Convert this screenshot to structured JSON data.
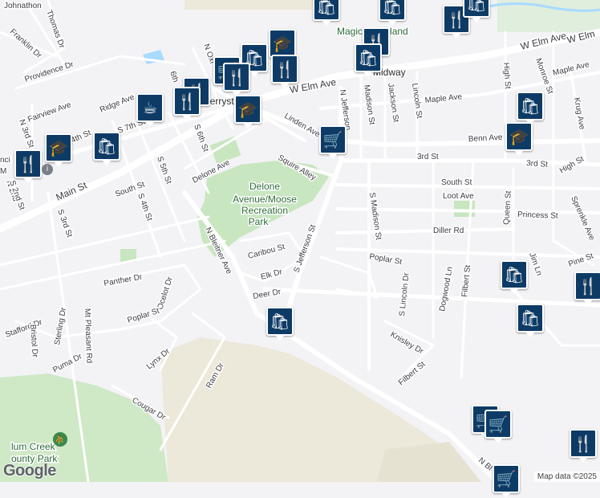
{
  "attribution": "Map data ©2025",
  "logo": "Google",
  "places": {
    "park": [
      "Delone",
      "Avenue/Moose",
      "Recreation",
      "Park"
    ],
    "midway": "Midway",
    "mcsherrystown": "herrystown",
    "skateland": "Magic    Skateland",
    "county_park": [
      "lum Creek",
      "ounty Park"
    ],
    "left_edge": [
      "nci",
      "M"
    ]
  },
  "streets": {
    "johnathon": "Johnathon",
    "thomas": "Thomas Dr",
    "franklin": "Franklin Dr",
    "providence": "Providence Dr",
    "fairview": "Fairview Ave",
    "ridge": "Ridge Ave",
    "n3rd": "N 3rd St",
    "n2nd": "N 2nd",
    "n4th": "4th St",
    "s5th": "S 5th St",
    "s6th": "S 6th St",
    "n6th": "6th",
    "s7th": "S 7th St",
    "n_oxford": "N Oxf",
    "main": "Main St",
    "south1": "South St",
    "s4th": "S 4th St",
    "s3rd": "S 3rd St",
    "s2nd": "S 2nd St",
    "delone": "Delone Ave",
    "squire": "Squire Alley",
    "linden": "Linden Ave",
    "w_elm1": "W Elm Ave",
    "w_elm2": "W Elm Ave",
    "n_jefferson": "N Jefferson",
    "madison_n": "Madison St",
    "jackson": "Jackson St",
    "lincoln_n": "Lincoln St",
    "maple1": "Maple Ave",
    "maple2": "Maple Ave",
    "benn": "Benn Ave",
    "third": "3rd St",
    "third2": "3rd St",
    "south2": "South St",
    "loot": "Loot Ave",
    "princess": "Princess St",
    "diller": "Diller Rd",
    "s_madison": "S Madison St",
    "poplar_e": "Poplar St",
    "s_jefferson": "S Jefferson St",
    "caribou": "Caribou St",
    "elk": "Elk Dr",
    "deer": "Deer Dr",
    "n_bleitner": "N Bleitner Ave",
    "panther": "Panther Dr",
    "ocelot": "Ocelot Dr",
    "poplar_w": "Poplar St",
    "stafford": "Stafford Dr",
    "bristol": "Bristol Dr",
    "sterling": "Sterling Dr",
    "mt_pleasant": "Mt Pleasant Rd",
    "puma": "Puma Dr",
    "lynx": "Lynx Dr",
    "ram": "Ram Dr",
    "cougar": "Cougar Dr",
    "s_lincoln": "S Lincoln Dr",
    "dogwood": "Dogwood Ln",
    "filbert1": "Filbert St",
    "filbert2": "Filbert St",
    "knisley": "Knisley Dr",
    "queen": "Queen St",
    "sprenkle": "Sprenkle Ave",
    "high1": "High St",
    "high2": "High St",
    "monroe": "Monroe St",
    "krug": "Krug Ave",
    "pine": "Pine St",
    "jim": "Jim  Ln",
    "n_bl": "N Bl",
    "w_elm3": "W Elm"
  },
  "poi_icons": {
    "shopping": "🛍",
    "restaurant": "🍴",
    "school": "🎓",
    "cafe": "☕",
    "grocery": "🛒"
  },
  "colors": {
    "poi_marker": "#0d3b66",
    "park": "#c8e6c0",
    "road": "#ffffff",
    "background": "#f3f2f5",
    "sand": "#ece8da"
  }
}
